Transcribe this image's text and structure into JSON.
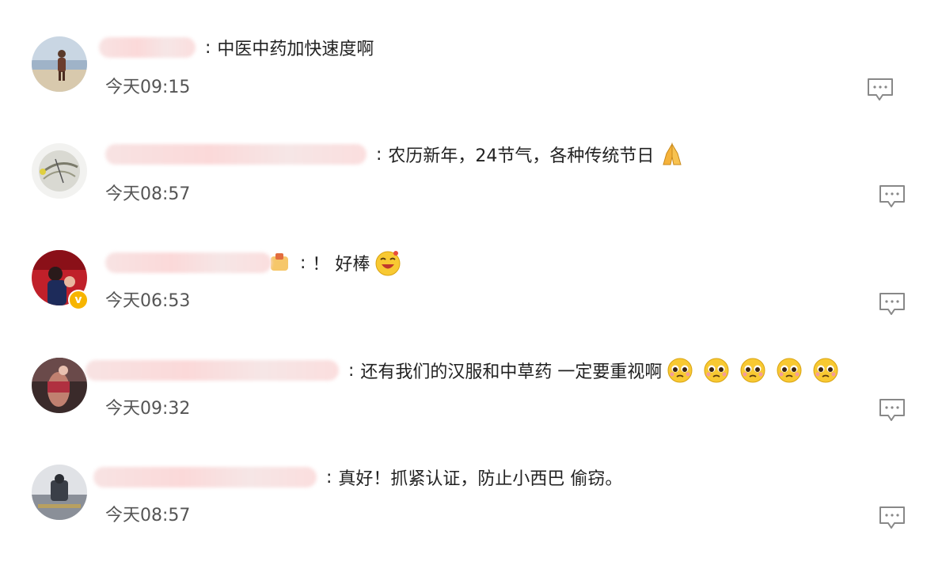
{
  "comments": [
    {
      "text": "中医中药加快速度啊",
      "time": "今天09:15",
      "emojis": []
    },
    {
      "text": "农历新年，24节气，各种传统节日",
      "time": "今天08:57",
      "emojis": [
        "folded-hands-emoji"
      ]
    },
    {
      "text": "！ 好棒",
      "time": "今天06:53",
      "verified": true,
      "emojis": [
        "happy-face-emoji"
      ]
    },
    {
      "text": "还有我们的汉服和中草药 一定要重视啊",
      "time": "今天09:32",
      "emojis": [
        "pleading-face-emoji",
        "pleading-face-emoji",
        "pleading-face-emoji",
        "pleading-face-emoji",
        "pleading-face-emoji"
      ]
    },
    {
      "text": "真好！抓紧认证，防止小西巴 偷窃。",
      "time": "今天08:57",
      "emojis": []
    }
  ],
  "colors": {
    "name_blur": "#f9dede",
    "time": "#555555",
    "text": "#222222",
    "verified_badge": "#f7b500",
    "reply_icon": "#888888"
  },
  "icons": {
    "reply": "comment-reply-icon",
    "verified": "verified-badge-icon"
  }
}
